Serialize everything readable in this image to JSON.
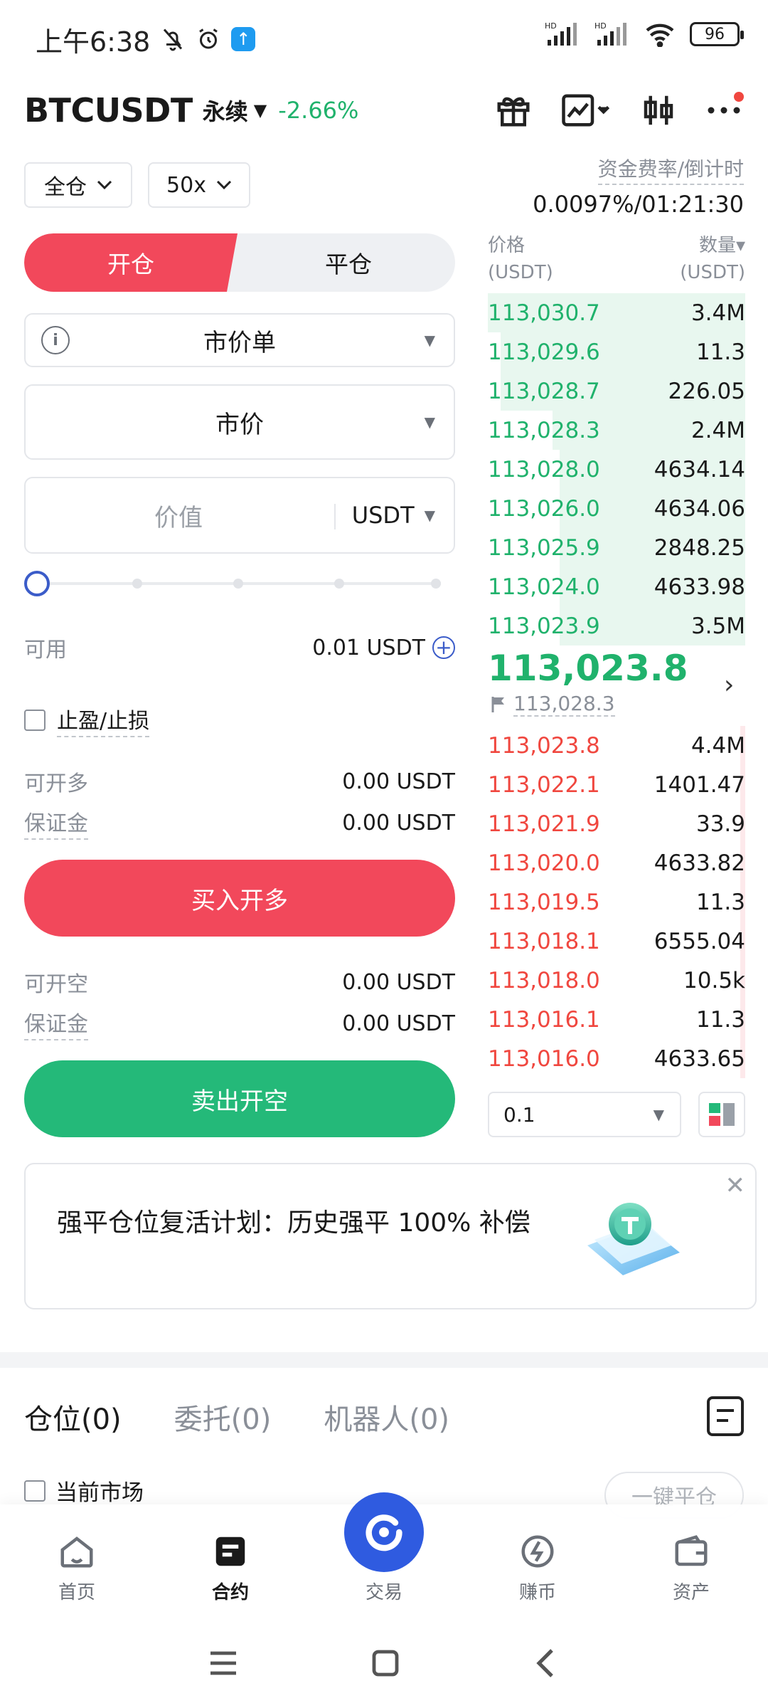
{
  "status_bar": {
    "time": "上午6:38",
    "signal1": "HD",
    "signal2": "HD",
    "battery": "96"
  },
  "header": {
    "pair": "BTCUSDT",
    "contract_type": "永续",
    "change": "-2.66%"
  },
  "controls": {
    "margin_mode": "全仓",
    "leverage": "50x",
    "funding_label": "资金费率/倒计时",
    "funding_value": "0.0097%/01:21:30"
  },
  "order_form": {
    "open_tab": "开仓",
    "close_tab": "平仓",
    "order_type": "市价单",
    "price_mode": "市价",
    "value_placeholder": "价值",
    "unit": "USDT",
    "available_label": "可用",
    "available_value": "0.01 USDT",
    "tpsl_label": "止盈/止损",
    "can_open_long_label": "可开多",
    "can_open_long_value": "0.00 USDT",
    "margin_label_long": "保证金",
    "margin_value_long": "0.00 USDT",
    "buy_button": "买入开多",
    "can_open_short_label": "可开空",
    "can_open_short_value": "0.00 USDT",
    "margin_label_short": "保证金",
    "margin_value_short": "0.00 USDT",
    "sell_button": "卖出开空",
    "slider_percent": 0
  },
  "order_book": {
    "price_header": "价格",
    "price_unit": "(USDT)",
    "qty_header": "数量▾",
    "qty_unit": "(USDT)",
    "asks": [
      {
        "price": "113,030.7",
        "qty": "3.4M",
        "depth": 1.0
      },
      {
        "price": "113,029.6",
        "qty": "11.3",
        "depth": 0.95
      },
      {
        "price": "113,028.7",
        "qty": "226.05",
        "depth": 0.95
      },
      {
        "price": "113,028.3",
        "qty": "2.4M",
        "depth": 0.75
      },
      {
        "price": "113,028.0",
        "qty": "4634.14",
        "depth": 0.72
      },
      {
        "price": "113,026.0",
        "qty": "4634.06",
        "depth": 0.72
      },
      {
        "price": "113,025.9",
        "qty": "2848.25",
        "depth": 0.72
      },
      {
        "price": "113,024.0",
        "qty": "4633.98",
        "depth": 0.72
      },
      {
        "price": "113,023.9",
        "qty": "3.5M",
        "depth": 0.72
      }
    ],
    "last_price": "113,023.8",
    "mark_price": "113,028.3",
    "bids": [
      {
        "price": "113,023.8",
        "qty": "4.4M",
        "depth": 0.02
      },
      {
        "price": "113,022.1",
        "qty": "1401.47",
        "depth": 0.02
      },
      {
        "price": "113,021.9",
        "qty": "33.9",
        "depth": 0.02
      },
      {
        "price": "113,020.0",
        "qty": "4633.82",
        "depth": 0.02
      },
      {
        "price": "113,019.5",
        "qty": "11.3",
        "depth": 0.02
      },
      {
        "price": "113,018.1",
        "qty": "6555.04",
        "depth": 0.02
      },
      {
        "price": "113,018.0",
        "qty": "10.5k",
        "depth": 0.02
      },
      {
        "price": "113,016.1",
        "qty": "11.3",
        "depth": 0.02
      },
      {
        "price": "113,016.0",
        "qty": "4633.65",
        "depth": 0.02
      }
    ],
    "depth_step": "0.1"
  },
  "banner": {
    "text": "强平仓位复活计划：历史强平 100% 补偿"
  },
  "positions": {
    "tabs": [
      "仓位(0)",
      "委托(0)",
      "机器人(0)"
    ],
    "current_market": "当前市场",
    "close_all": "一键平仓"
  },
  "bottom_nav": {
    "items": [
      "首页",
      "合约",
      "交易",
      "赚币",
      "资产"
    ]
  },
  "colors": {
    "buy_red": "#f2485b",
    "sell_green": "#24b979",
    "ask_green": "#20b26c",
    "bid_red": "#f0473f",
    "accent_blue": "#2f5be0"
  }
}
